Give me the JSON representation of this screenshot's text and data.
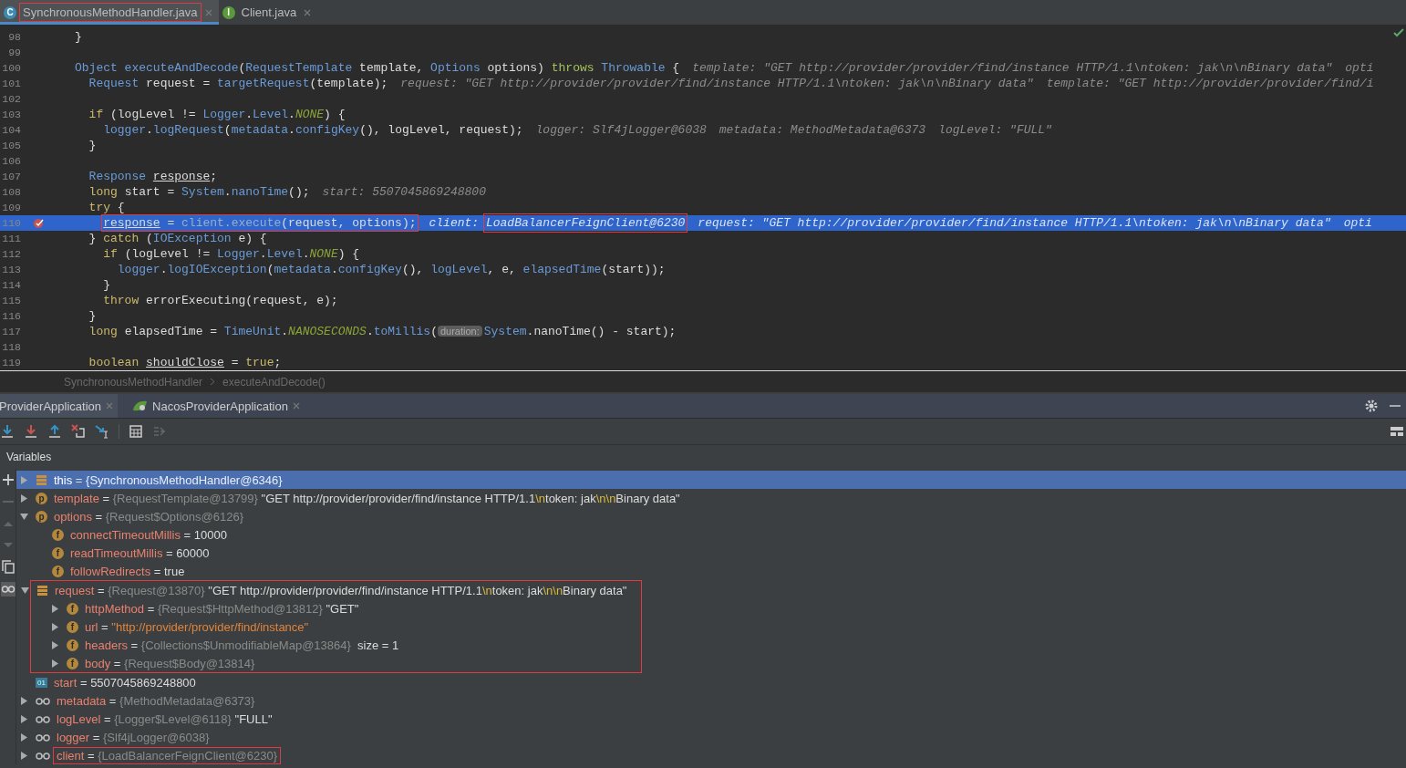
{
  "editor_tabs": [
    {
      "label": "SynchronousMethodHandler.java",
      "kind": "class",
      "icon_text": "C",
      "selected": true,
      "boxed": true
    },
    {
      "label": "Client.java",
      "kind": "interface",
      "icon_text": "I",
      "selected": false,
      "boxed": false
    }
  ],
  "code_lines": [
    {
      "number": "98",
      "tokens": [
        {
          "kind": "plain",
          "text": "}"
        }
      ]
    },
    {
      "number": "99"
    },
    {
      "number": "100",
      "tokens": [
        {
          "kind": "type",
          "text": "Object "
        },
        {
          "kind": "method",
          "text": "executeAndDecode"
        },
        {
          "kind": "plain",
          "text": "("
        },
        {
          "kind": "type",
          "text": "RequestTemplate "
        },
        {
          "kind": "plain",
          "text": "template, "
        },
        {
          "kind": "type",
          "text": "Options "
        },
        {
          "kind": "plain",
          "text": "options) "
        },
        {
          "kind": "modifier",
          "text": "throws "
        },
        {
          "kind": "type",
          "text": "Throwable "
        },
        {
          "kind": "plain",
          "text": "{"
        }
      ],
      "hints": [
        {
          "label": "template:",
          "value": "\"GET http://provider/provider/find/instance HTTP/1.1\\ntoken: jak\\n\\nBinary data\""
        },
        {
          "label": "opti"
        }
      ]
    },
    {
      "number": "101",
      "tokens": [
        {
          "kind": "type",
          "text": "  Request "
        },
        {
          "kind": "plain",
          "text": "request = "
        },
        {
          "kind": "method",
          "text": "targetRequest"
        },
        {
          "kind": "plain",
          "text": "(template);"
        }
      ],
      "hints": [
        {
          "label": "request:",
          "value": "\"GET http://provider/provider/find/instance HTTP/1.1\\ntoken: jak\\n\\nBinary data\""
        },
        {
          "label": "template:",
          "value": "\"GET http://provider/provider/find/i"
        }
      ]
    },
    {
      "number": "102"
    },
    {
      "number": "103",
      "tokens": [
        {
          "kind": "keyword",
          "text": "  if "
        },
        {
          "kind": "plain",
          "text": "(logLevel != "
        },
        {
          "kind": "type",
          "text": "Logger"
        },
        {
          "kind": "plain",
          "text": "."
        },
        {
          "kind": "type",
          "text": "Level"
        },
        {
          "kind": "plain",
          "text": "."
        },
        {
          "kind": "constant",
          "text": "NONE"
        },
        {
          "kind": "plain",
          "text": ") {"
        }
      ]
    },
    {
      "number": "104",
      "tokens": [
        {
          "kind": "method",
          "text": "    logger"
        },
        {
          "kind": "plain",
          "text": "."
        },
        {
          "kind": "method",
          "text": "logRequest"
        },
        {
          "kind": "plain",
          "text": "("
        },
        {
          "kind": "method",
          "text": "metadata"
        },
        {
          "kind": "plain",
          "text": "."
        },
        {
          "kind": "method",
          "text": "configKey"
        },
        {
          "kind": "plain",
          "text": "(), logLevel, request);"
        }
      ],
      "hints": [
        {
          "label": "logger:",
          "value": "Slf4jLogger@6038"
        },
        {
          "label": "metadata:",
          "value": "MethodMetadata@6373"
        },
        {
          "label": "logLevel:",
          "value": "\"FULL\""
        }
      ]
    },
    {
      "number": "105",
      "tokens": [
        {
          "kind": "plain",
          "text": "  }"
        }
      ]
    },
    {
      "number": "106"
    },
    {
      "number": "107",
      "tokens": [
        {
          "kind": "type",
          "text": "  Response "
        },
        {
          "kind": "underlined",
          "text": "response"
        },
        {
          "kind": "plain",
          "text": ";"
        }
      ]
    },
    {
      "number": "108",
      "tokens": [
        {
          "kind": "keyword",
          "text": "  long "
        },
        {
          "kind": "plain",
          "text": "start = "
        },
        {
          "kind": "type",
          "text": "System"
        },
        {
          "kind": "plain",
          "text": "."
        },
        {
          "kind": "method",
          "text": "nanoTime"
        },
        {
          "kind": "plain",
          "text": "();"
        }
      ],
      "hints": [
        {
          "label": "start:",
          "value": "5507045869248800"
        }
      ]
    },
    {
      "number": "109",
      "tokens": [
        {
          "kind": "keyword",
          "text": "  try "
        },
        {
          "kind": "plain",
          "text": "{"
        }
      ]
    },
    {
      "number": "110",
      "current": true,
      "breakpoint": true,
      "boxed": true,
      "tokens": [
        {
          "kind": "underlined",
          "text": "    response"
        },
        {
          "kind": "plain",
          "text": " = "
        },
        {
          "kind": "dim",
          "text": "client.execute"
        },
        {
          "kind": "plain",
          "text": "(request, options);"
        }
      ],
      "hints": [
        {
          "label": "client:",
          "value": "LoadBalancerFeignClient@6230",
          "boxed": true
        },
        {
          "label": "request:",
          "value": "\"GET http://provider/provider/find/instance HTTP/1.1\\ntoken: jak\\n\\nBinary data\""
        },
        {
          "label": "opti"
        }
      ]
    },
    {
      "number": "111",
      "tokens": [
        {
          "kind": "plain",
          "text": "  } "
        },
        {
          "kind": "keyword",
          "text": "catch "
        },
        {
          "kind": "plain",
          "text": "("
        },
        {
          "kind": "type",
          "text": "IOException "
        },
        {
          "kind": "plain",
          "text": "e) {"
        }
      ]
    },
    {
      "number": "112",
      "tokens": [
        {
          "kind": "keyword",
          "text": "    if "
        },
        {
          "kind": "plain",
          "text": "(logLevel != "
        },
        {
          "kind": "type",
          "text": "Logger"
        },
        {
          "kind": "plain",
          "text": "."
        },
        {
          "kind": "type",
          "text": "Level"
        },
        {
          "kind": "plain",
          "text": "."
        },
        {
          "kind": "constant",
          "text": "NONE"
        },
        {
          "kind": "plain",
          "text": ") {"
        }
      ]
    },
    {
      "number": "113",
      "tokens": [
        {
          "kind": "method",
          "text": "      logger"
        },
        {
          "kind": "plain",
          "text": "."
        },
        {
          "kind": "method",
          "text": "logIOException"
        },
        {
          "kind": "plain",
          "text": "("
        },
        {
          "kind": "method",
          "text": "metadata"
        },
        {
          "kind": "plain",
          "text": "."
        },
        {
          "kind": "method",
          "text": "configKey"
        },
        {
          "kind": "plain",
          "text": "(), "
        },
        {
          "kind": "method",
          "text": "logLevel"
        },
        {
          "kind": "plain",
          "text": ", e, "
        },
        {
          "kind": "method",
          "text": "elapsedTime"
        },
        {
          "kind": "plain",
          "text": "(start));"
        }
      ]
    },
    {
      "number": "114",
      "tokens": [
        {
          "kind": "plain",
          "text": "    }"
        }
      ]
    },
    {
      "number": "115",
      "tokens": [
        {
          "kind": "keyword",
          "text": "    throw "
        },
        {
          "kind": "plain",
          "text": "errorExecuting(request, e);"
        }
      ]
    },
    {
      "number": "116",
      "tokens": [
        {
          "kind": "plain",
          "text": "  }"
        }
      ]
    },
    {
      "number": "117",
      "tokens": [
        {
          "kind": "keyword",
          "text": "  long "
        },
        {
          "kind": "plain",
          "text": "elapsedTime = "
        },
        {
          "kind": "type",
          "text": "TimeUnit"
        },
        {
          "kind": "plain",
          "text": "."
        },
        {
          "kind": "constant",
          "text": "NANOSECONDS"
        },
        {
          "kind": "plain",
          "text": "."
        },
        {
          "kind": "method",
          "text": "toMillis"
        },
        {
          "kind": "plain",
          "text": "("
        },
        {
          "kind": "chip",
          "text": "duration:"
        },
        {
          "kind": "type",
          "text": "System"
        },
        {
          "kind": "plain",
          "text": ".nanoTime() - start);"
        }
      ]
    },
    {
      "number": "118"
    },
    {
      "number": "119",
      "tokens": [
        {
          "kind": "keyword",
          "text": "  boolean "
        },
        {
          "kind": "underlined",
          "text": "shouldClose"
        },
        {
          "kind": "plain",
          "text": " = "
        },
        {
          "kind": "keyword",
          "text": "true"
        },
        {
          "kind": "plain",
          "text": ";"
        }
      ]
    }
  ],
  "breadcrumb": [
    "SynchronousMethodHandler",
    "executeAndDecode()"
  ],
  "debug_tabs": [
    {
      "label": "ProviderApplication",
      "selected": true
    },
    {
      "label": "NacosProviderApplication",
      "selected": false
    }
  ],
  "variables": {
    "title": "Variables",
    "nodes": [
      {
        "kind": "object",
        "name": "this",
        "assign": "=",
        "type_text": "{SynchronousMethodHandler@6346}",
        "expanded": false,
        "selected": true
      },
      {
        "kind": "param",
        "icon_text": "p",
        "name": "template",
        "assign": "=",
        "type_text": "{RequestTemplate@13799}",
        "value": [
          {
            "kind": "string",
            "text": "\"GET http://provider/provider/find/instance HTTP/1.1"
          },
          {
            "kind": "escape",
            "text": "\\n"
          },
          {
            "kind": "string",
            "text": "token: jak"
          },
          {
            "kind": "escape",
            "text": "\\n"
          },
          {
            "kind": "escape",
            "text": "\\n"
          },
          {
            "kind": "string",
            "text": "Binary data\""
          }
        ],
        "expanded": false,
        "selected": false
      },
      {
        "kind": "param",
        "icon_text": "p",
        "name": "options",
        "assign": "=",
        "type_text": "{Request$Options@6126}",
        "expanded": true,
        "selected": false,
        "children": [
          {
            "kind": "field",
            "icon_text": "f",
            "name": "connectTimeoutMillis",
            "assign": "=",
            "value": [
              {
                "kind": "string",
                "text": "10000"
              }
            ],
            "selected": false
          },
          {
            "kind": "field",
            "icon_text": "f",
            "name": "readTimeoutMillis",
            "assign": "=",
            "value": [
              {
                "kind": "string",
                "text": "60000"
              }
            ],
            "selected": false
          },
          {
            "kind": "field",
            "icon_text": "f",
            "name": "followRedirects",
            "assign": "=",
            "value": [
              {
                "kind": "string",
                "text": "true"
              }
            ],
            "selected": false
          }
        ]
      },
      {
        "kind": "object",
        "name": "request",
        "assign": "=",
        "type_text": "{Request@13870}",
        "value": [
          {
            "kind": "string",
            "text": "\"GET http://provider/provider/find/instance HTTP/1.1"
          },
          {
            "kind": "escape",
            "text": "\\n"
          },
          {
            "kind": "string",
            "text": "token: jak"
          },
          {
            "kind": "escape",
            "text": "\\n"
          },
          {
            "kind": "escape",
            "text": "\\n"
          },
          {
            "kind": "string",
            "text": "Binary data\""
          }
        ],
        "expanded": true,
        "selected": false,
        "boxed": true,
        "children": [
          {
            "kind": "field",
            "icon_text": "f",
            "name": "httpMethod",
            "assign": "=",
            "type_text": "{Request$HttpMethod@13812}",
            "value": [
              {
                "kind": "string",
                "text": "\"GET\""
              }
            ],
            "expanded": false,
            "selected": false
          },
          {
            "kind": "field",
            "icon_text": "f",
            "name": "url",
            "assign": "=",
            "value": [
              {
                "kind": "url",
                "text": "\"http://provider/provider/find/instance\""
              }
            ],
            "expanded": false,
            "selected": false
          },
          {
            "kind": "field",
            "icon_text": "f",
            "name": "headers",
            "assign": "=",
            "type_text": "{Collections$UnmodifiableMap@13864}",
            "extra": "size = 1",
            "expanded": false,
            "selected": false
          },
          {
            "kind": "field",
            "icon_text": "f",
            "name": "body",
            "assign": "=",
            "type_text": "{Request$Body@13814}",
            "expanded": false,
            "selected": false
          }
        ]
      },
      {
        "kind": "primitive",
        "icon_text": "01",
        "name": "start",
        "assign": "=",
        "value": [
          {
            "kind": "string",
            "text": "5507045869248800"
          }
        ],
        "selected": false
      },
      {
        "kind": "watch",
        "name": "metadata",
        "assign": "=",
        "type_text": "{MethodMetadata@6373}",
        "expanded": false,
        "selected": false
      },
      {
        "kind": "watch",
        "name": "logLevel",
        "assign": "=",
        "type_text": "{Logger$Level@6118}",
        "value": [
          {
            "kind": "string",
            "text": "\"FULL\""
          }
        ],
        "expanded": false,
        "selected": false
      },
      {
        "kind": "watch",
        "name": "logger",
        "assign": "=",
        "type_text": "{Slf4jLogger@6038}",
        "expanded": false,
        "selected": false
      },
      {
        "kind": "watch",
        "name": "client",
        "assign": "=",
        "type_text": "{LoadBalancerFeignClient@6230}",
        "expanded": false,
        "selected": false,
        "boxed": true
      }
    ]
  }
}
